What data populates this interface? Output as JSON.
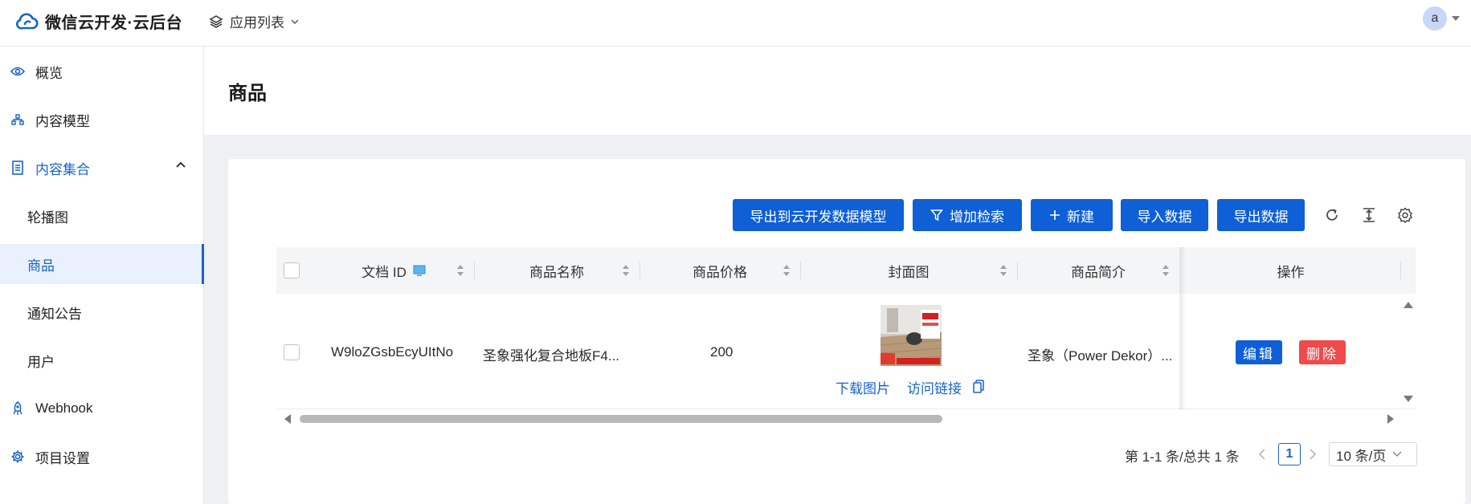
{
  "header": {
    "brand_title": "微信云开发·云后台",
    "app_switch_label": "应用列表",
    "avatar_letter": "a"
  },
  "sidebar": {
    "items": [
      {
        "label": "概览",
        "icon": "eye-icon"
      },
      {
        "label": "内容模型",
        "icon": "sitemap-icon"
      },
      {
        "label": "内容集合",
        "icon": "document-icon"
      },
      {
        "label": "轮播图"
      },
      {
        "label": "商品"
      },
      {
        "label": "通知公告"
      },
      {
        "label": "用户"
      },
      {
        "label": "Webhook",
        "icon": "rocket-icon"
      },
      {
        "label": "项目设置",
        "icon": "gear-icon"
      }
    ]
  },
  "page": {
    "title": "商品"
  },
  "toolbar": {
    "export_model": "导出到云开发数据模型",
    "add_filter": "增加检索",
    "create": "新建",
    "import": "导入数据",
    "export": "导出数据"
  },
  "table": {
    "columns": [
      "文档 ID",
      "商品名称",
      "商品价格",
      "封面图",
      "商品简介",
      "操作"
    ],
    "rows": [
      {
        "doc_id": "W9loZGsbEcyUItNo",
        "name": "圣象强化复合地板F4...",
        "price": "200",
        "cover_download": "下载图片",
        "cover_visit": "访问链接",
        "description": "圣象（Power Dekor）...",
        "edit": "编辑",
        "delete": "删除"
      }
    ]
  },
  "pagination": {
    "summary": "第 1-1 条/总共 1 条",
    "current_page": "1",
    "page_size": "10 条/页"
  },
  "colors": {
    "primary": "#0f5fd6",
    "danger": "#f04a4a",
    "sidebar_active_bg": "#e9f1fd"
  }
}
